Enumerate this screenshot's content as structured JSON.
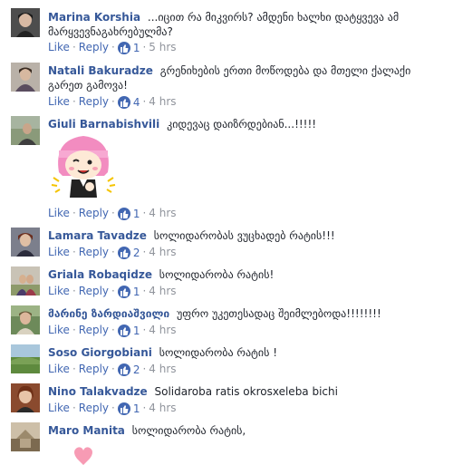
{
  "actions": {
    "like": "Like",
    "reply": "Reply",
    "separator": "·"
  },
  "comments": [
    {
      "name": "Marina Korshia",
      "text": "...იცით რა მიკვირს? ამდენი ხალხი დატყვევა ამ მარყვევნაგახრებულმა?",
      "likes": "1",
      "time": "5 hrs"
    },
    {
      "name": "Natali Bakuradze",
      "text": "გრენიხების ერთი მოწოდება და მთელი ქალაქი გარეთ გამოვა!",
      "likes": "4",
      "time": "4 hrs"
    },
    {
      "name": "Giuli Barnabishvili",
      "text": "კიდევაც დაიზრდებიან...!!!!!",
      "likes": "1",
      "time": "4 hrs"
    },
    {
      "name": "Lamara Tavadze",
      "text": "სოლიდარობას ვუცხადებ რატის!!!",
      "likes": "2",
      "time": "4 hrs"
    },
    {
      "name": "Griala Robaqidze",
      "text": "სოლიდარობა რატის!",
      "likes": "1",
      "time": "4 hrs"
    },
    {
      "name": "მარინე ზარდიაშვილი",
      "text": "უფრო უკეთესადაც შეიმლებოდა!!!!!!!!",
      "likes": "1",
      "time": "4 hrs"
    },
    {
      "name": "Soso Giorgobiani",
      "text": "სოლიდარობა რატის !",
      "likes": "2",
      "time": "4 hrs"
    },
    {
      "name": "Nino Talakvadze",
      "text": "Solidaroba ratis okrosxeleba bichi",
      "likes": "1",
      "time": "4 hrs"
    },
    {
      "name": "Maro Manita",
      "text": "სოლიდარობა რატის,",
      "likes": "",
      "time": ""
    }
  ],
  "colors": {
    "name": "#365899",
    "action": "#4267b2",
    "meta": "#90949c",
    "like_badge": "#4267b2"
  },
  "icons": [
    "like-thumb-icon",
    "sticker-pink-hair-girl",
    "sticker-heart"
  ]
}
